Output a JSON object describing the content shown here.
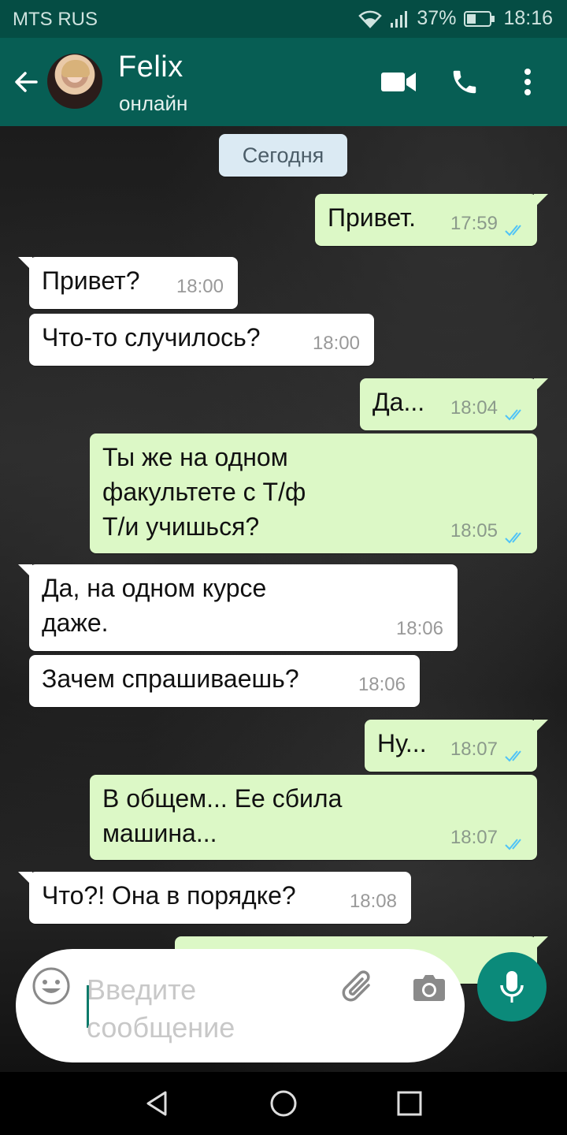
{
  "status_bar": {
    "carrier": "MTS RUS",
    "battery": "37%",
    "time": "18:16",
    "icons": [
      "wifi-icon",
      "signal-icon",
      "battery-icon"
    ]
  },
  "header": {
    "back_icon": "arrow-left-icon",
    "contact_name": "Felix",
    "contact_status": "онлайн",
    "actions": [
      "video-call-icon",
      "phone-icon",
      "more-vert-icon"
    ]
  },
  "chat": {
    "date_label": "Сегодня",
    "messages": [
      {
        "dir": "out",
        "text": "Привет.",
        "time": "17:59",
        "read": true
      },
      {
        "dir": "in",
        "text": "Привет?",
        "time": "18:00"
      },
      {
        "dir": "in",
        "text": "Что-то случилось?",
        "time": "18:00"
      },
      {
        "dir": "out",
        "text": "Да...",
        "time": "18:04",
        "read": true
      },
      {
        "dir": "out",
        "text": "Ты же на одном\nфакультете с Т/ф\nТ/и  учишься?",
        "time": "18:05",
        "read": true
      },
      {
        "dir": "in",
        "text": "Да, на одном курсе\nдаже.",
        "time": "18:06"
      },
      {
        "dir": "in",
        "text": "Зачем спрашиваешь?",
        "time": "18:06"
      },
      {
        "dir": "out",
        "text": "Ну...",
        "time": "18:07",
        "read": true
      },
      {
        "dir": "out",
        "text": "В общем... Ее сбила\nмашина...",
        "time": "18:07",
        "read": true
      },
      {
        "dir": "in",
        "text": "Что?! Она в порядке?",
        "time": "18:08"
      }
    ],
    "colors": {
      "outgoing": "#dcf8c6",
      "incoming": "#ffffff",
      "read_ticks": "#4fc3f7"
    }
  },
  "composer": {
    "placeholder": "Введите\nсообщение",
    "icons": [
      "emoji-icon",
      "attach-icon",
      "camera-icon",
      "mic-icon"
    ]
  },
  "nav": {
    "icons": [
      "back-triangle-icon",
      "home-circle-icon",
      "recents-square-icon"
    ]
  }
}
